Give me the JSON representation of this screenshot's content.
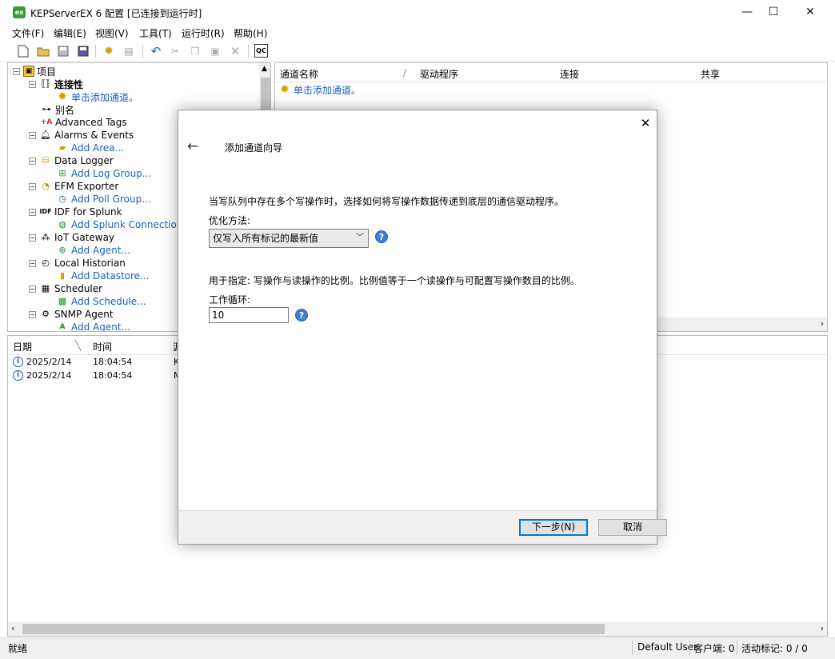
{
  "window": {
    "app_icon_text": "ex",
    "title": "KEPServerEX 6 配置 [已连接到运行时]",
    "minimize": "—",
    "maximize": "☐",
    "close": "✕"
  },
  "menu": [
    "文件(F)",
    "编辑(E)",
    "视图(V)",
    "工具(T)",
    "运行时(R)",
    "帮助(H)"
  ],
  "toolbar": {
    "icons": [
      "new-icon",
      "open-icon",
      "save-icon",
      "save-as-icon",
      "new-channel-icon",
      "new-device-icon",
      "undo-icon",
      "cut-icon",
      "copy-icon",
      "paste-icon",
      "delete-icon",
      "quick-client-icon"
    ],
    "quick_client_label": "QC"
  },
  "tree": {
    "root": "项目",
    "connectivity": "连接性",
    "add_channel": "单击添加通道。",
    "aliases": "别名",
    "advanced_tags": "Advanced Tags",
    "alarms_events": "Alarms & Events",
    "add_area": "Add Area...",
    "data_logger": "Data Logger",
    "add_log_group": "Add Log Group...",
    "efm_exporter": "EFM Exporter",
    "add_poll_group": "Add Poll Group...",
    "idf_splunk": "IDF for Splunk",
    "add_splunk": "Add Splunk Connection...",
    "iot_gateway": "IoT Gateway",
    "add_agent": "Add Agent...",
    "local_historian": "Local Historian",
    "add_datastore": "Add Datastore...",
    "scheduler": "Scheduler",
    "add_schedule": "Add Schedule...",
    "snmp_agent": "SNMP Agent",
    "add_agent_2": "Add Agent..."
  },
  "channel_list": {
    "columns": [
      "通道名称",
      "驱动程序",
      "连接",
      "共享"
    ],
    "sort_indicator": "/",
    "add_hint": "单击添加通道。"
  },
  "log": {
    "columns": [
      "日期",
      "时间",
      "源"
    ],
    "rows": [
      {
        "date": "2025/2/14",
        "time": "18:04:54",
        "source": "K"
      },
      {
        "date": "2025/2/14",
        "time": "18:04:54",
        "source": "M"
      }
    ]
  },
  "dialog": {
    "title": "添加通道向导",
    "description": "当写队列中存在多个写操作时，选择如何将写操作数据传递到底层的通信驱动程序。",
    "optimization_label": "优化方法:",
    "optimization_value": "仅写入所有标记的最新值",
    "ratio_description": "用于指定: 写操作与读操作的比例。比例值等于一个读操作与可配置写操作数目的比例。",
    "duty_cycle_label": "工作循环:",
    "duty_cycle_value": "10",
    "help": "?",
    "next_button": "下一步(N)",
    "cancel_button": "取消"
  },
  "status": {
    "ready": "就绪",
    "user": "Default User",
    "clients": "客户端: 0",
    "active_tags": "活动标记: 0 / 0"
  },
  "colors": {
    "link": "#1b5fbf",
    "accent": "#0078d7",
    "app_icon": "#3c9a3c"
  }
}
